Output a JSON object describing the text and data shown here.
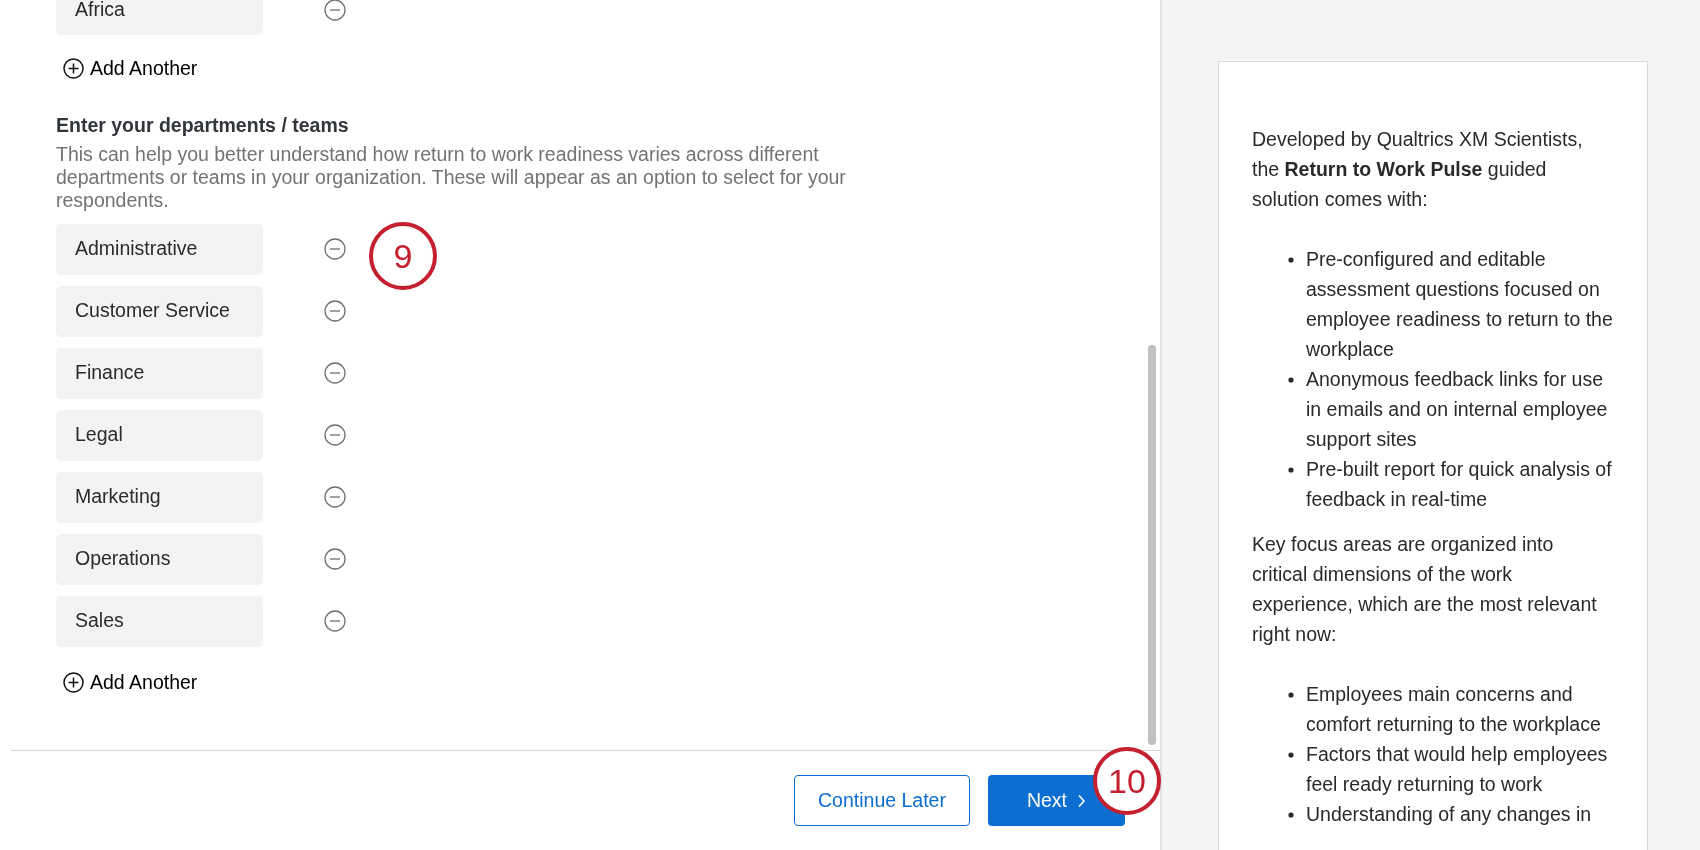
{
  "regions": {
    "items": [
      {
        "label": "Africa"
      }
    ],
    "add_label": "Add Another"
  },
  "departments": {
    "heading": "Enter your departments / teams",
    "description": "This can help you better understand how return to work readiness varies across different departments or teams in your organization. These will appear as an option to select for your respondents.",
    "items": [
      {
        "label": "Administrative"
      },
      {
        "label": "Customer Service"
      },
      {
        "label": "Finance"
      },
      {
        "label": "Legal"
      },
      {
        "label": "Marketing"
      },
      {
        "label": "Operations"
      },
      {
        "label": "Sales"
      }
    ],
    "add_label": "Add Another"
  },
  "footer": {
    "buttons": [
      {
        "label": "Continue Later",
        "kind": "secondary"
      },
      {
        "label": "Next",
        "kind": "primary"
      }
    ]
  },
  "annotations": [
    {
      "label": "9"
    },
    {
      "label": "10"
    }
  ],
  "info_card": {
    "blocks": [
      {
        "kind": "paragraph",
        "text": "Developed by Qualtrics XM Scientists, the **Return to Work Pulse** guided solution comes with:"
      },
      {
        "kind": "list",
        "items": [
          "Pre-configured and editable assessment questions focused on employee readiness to return to the workplace",
          "Anonymous feedback links for use in emails and on internal employee support sites",
          "Pre-built report for quick analysis of feedback in real-time"
        ]
      },
      {
        "kind": "paragraph",
        "text": "Key focus areas are organized into critical dimensions of the work experience, which are the most relevant right now:"
      },
      {
        "kind": "list",
        "items": [
          "Employees main concerns and comfort returning to the workplace",
          "Factors that would help employees feel ready returning to work",
          "Understanding of any changes in"
        ]
      }
    ]
  }
}
